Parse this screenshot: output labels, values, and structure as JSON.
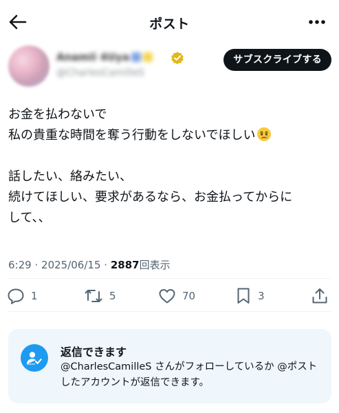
{
  "header": {
    "title": "ポスト",
    "back_icon": "arrow-left-icon",
    "more_icon": "more-dots-icon"
  },
  "author": {
    "name": "Anamii 4Uya",
    "handle": "@CharlesCamilleS",
    "verified": true,
    "subscribe_label": "サブスクライブする"
  },
  "tweet": {
    "lines": [
      "お金を払わないで",
      "私の貴重な時間を奪う行動をしないでほしい",
      "",
      "話したい、絡みたい、",
      "続けてほしい、要求があるなら、お金払ってからに",
      "して、、"
    ],
    "emoji": "face-holding-back-tears"
  },
  "meta": {
    "time": "6:29",
    "separator": "·",
    "date": "2025/06/15",
    "views_count": "2887",
    "views_label": "回表示"
  },
  "actions": {
    "replies": "1",
    "reposts": "5",
    "likes": "70",
    "bookmarks": "3"
  },
  "reply_notice": {
    "title": "返信できます",
    "text": "@CharlesCamilleS さんがフォローしているか @ポストしたアカウントが返信できます。"
  },
  "colors": {
    "text": "#0f1419",
    "muted": "#536471",
    "accent": "#1d9bf0",
    "notice_bg": "#eff6fc",
    "verified_gold": "#e2b719"
  }
}
